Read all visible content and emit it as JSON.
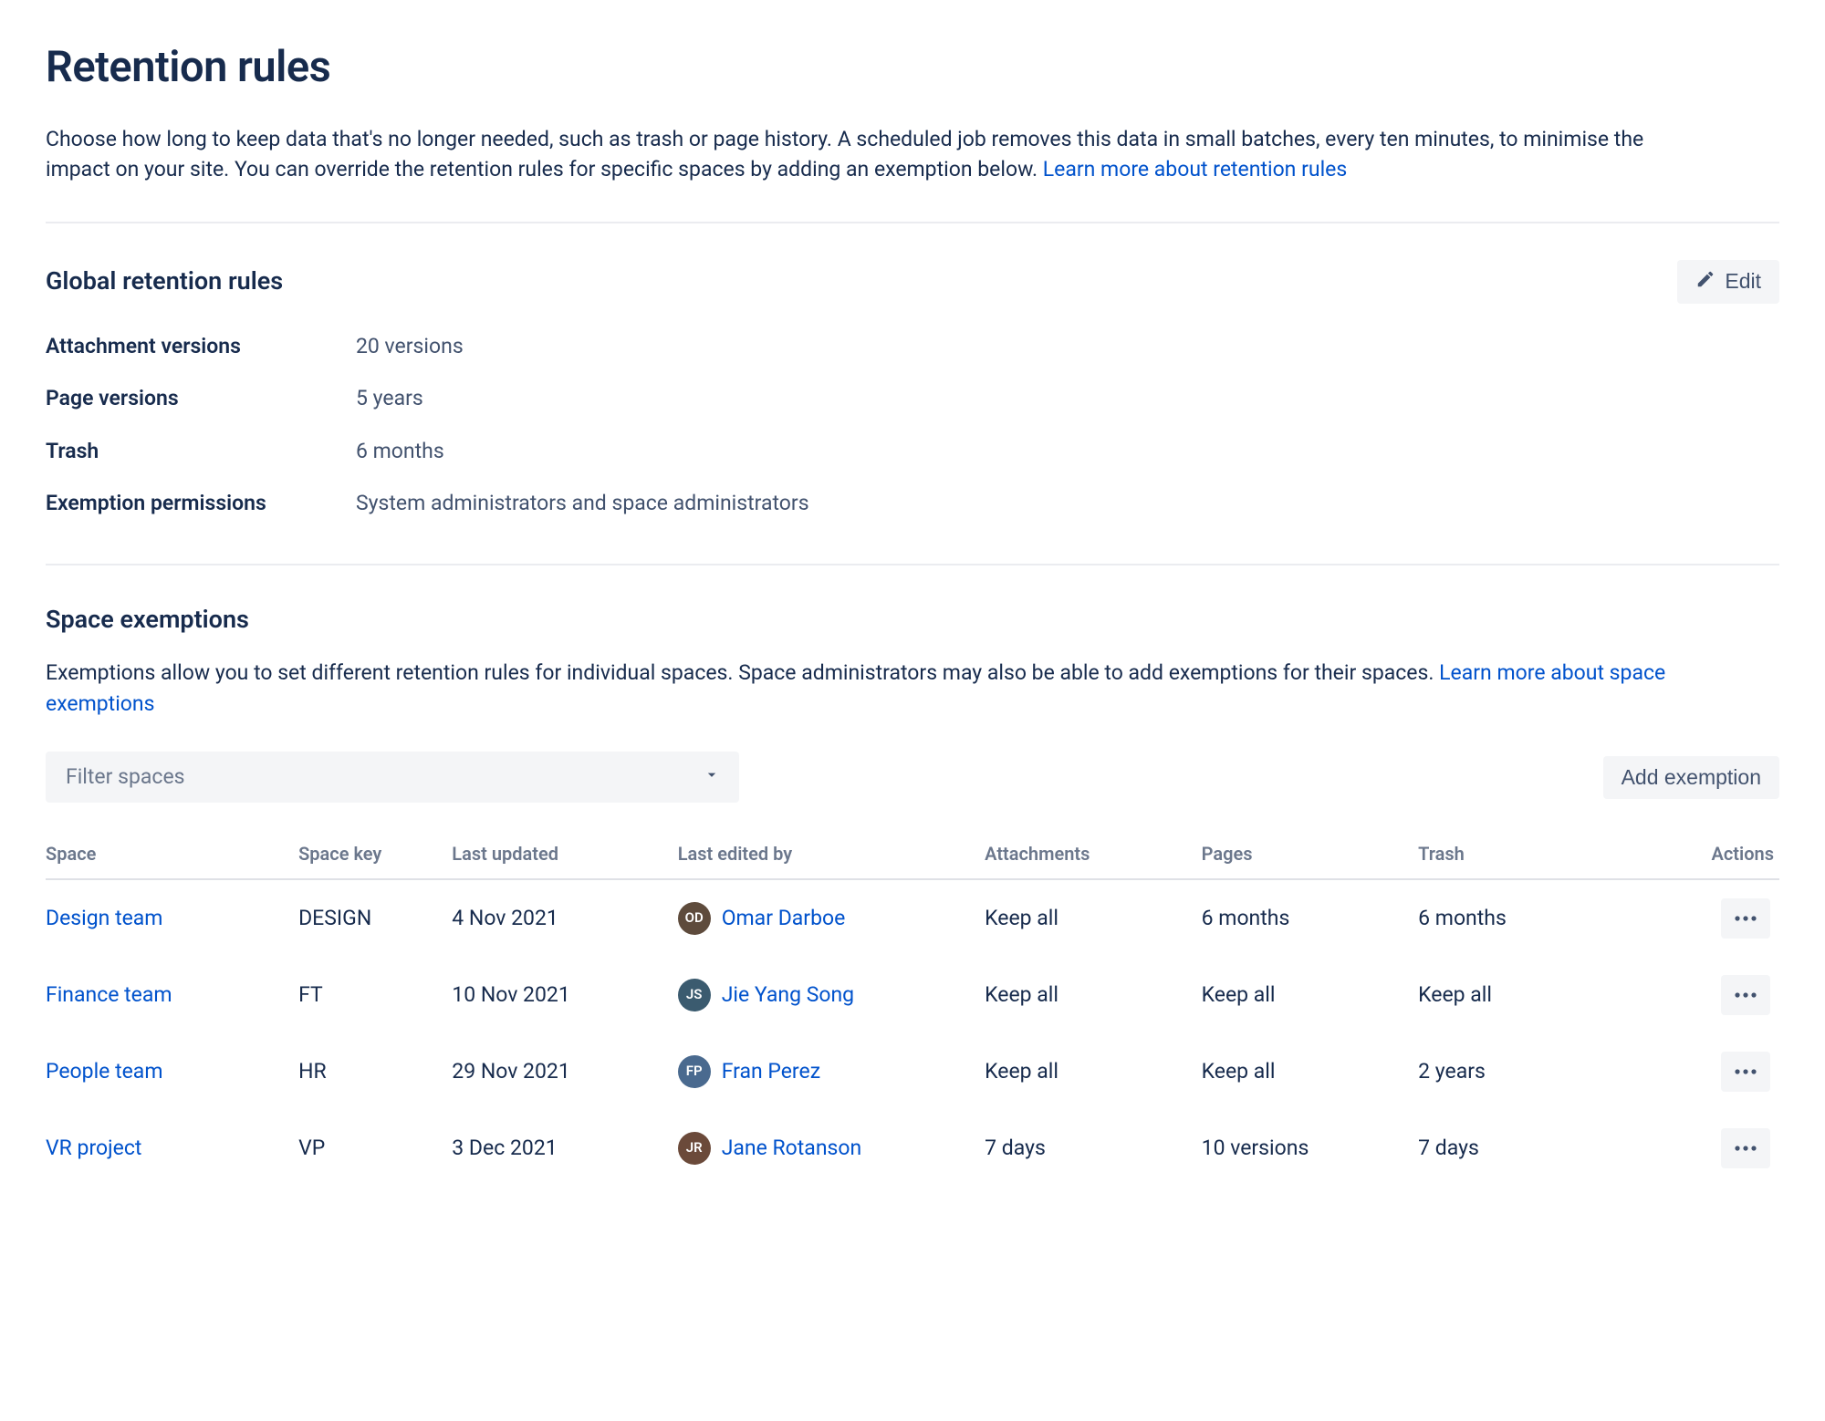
{
  "page": {
    "title": "Retention rules",
    "description": "Choose how long to keep data that's no longer needed, such as trash or page history. A scheduled job removes this data in small batches, every ten minutes, to minimise the impact on your site. You can override the retention rules for specific spaces by adding an exemption below. ",
    "learn_more": "Learn more about retention rules"
  },
  "global": {
    "title": "Global retention rules",
    "edit_label": "Edit",
    "rows": [
      {
        "label": "Attachment versions",
        "value": "20 versions"
      },
      {
        "label": "Page versions",
        "value": "5 years"
      },
      {
        "label": "Trash",
        "value": "6 months"
      },
      {
        "label": "Exemption permissions",
        "value": "System administrators and space administrators"
      }
    ]
  },
  "exemptions": {
    "title": "Space exemptions",
    "description": "Exemptions allow you to set different retention rules for individual spaces. Space administrators may also be able to add exemptions for their spaces. ",
    "learn_more": "Learn more about space exemptions",
    "filter_placeholder": "Filter spaces",
    "add_label": "Add exemption",
    "columns": {
      "space": "Space",
      "key": "Space key",
      "updated": "Last updated",
      "edited_by": "Last edited by",
      "attachments": "Attachments",
      "pages": "Pages",
      "trash": "Trash",
      "actions": "Actions"
    },
    "rows": [
      {
        "space": "Design team",
        "key": "DESIGN",
        "updated": "4 Nov 2021",
        "editor": {
          "name": "Omar Darboe",
          "initials": "OD",
          "color": "#5E4B3C"
        },
        "attachments": "Keep all",
        "pages": "6 months",
        "trash": "6 months"
      },
      {
        "space": "Finance team",
        "key": "FT",
        "updated": "10 Nov 2021",
        "editor": {
          "name": "Jie Yang Song",
          "initials": "JS",
          "color": "#3B5B6F"
        },
        "attachments": "Keep all",
        "pages": "Keep all",
        "trash": "Keep all"
      },
      {
        "space": "People team",
        "key": "HR",
        "updated": "29 Nov 2021",
        "editor": {
          "name": "Fran Perez",
          "initials": "FP",
          "color": "#4A6A8F"
        },
        "attachments": "Keep all",
        "pages": "Keep all",
        "trash": "2 years"
      },
      {
        "space": "VR project",
        "key": "VP",
        "updated": "3 Dec 2021",
        "editor": {
          "name": "Jane Rotanson",
          "initials": "JR",
          "color": "#6B4A3A"
        },
        "attachments": "7 days",
        "pages": "10 versions",
        "trash": "7 days"
      }
    ]
  }
}
